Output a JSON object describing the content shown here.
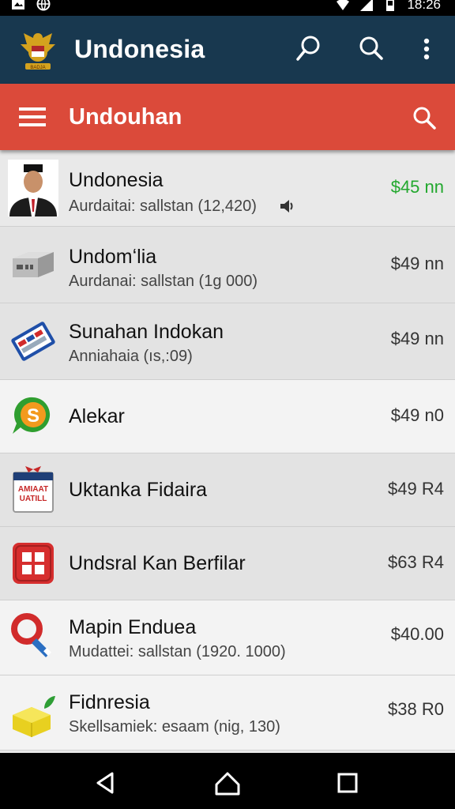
{
  "statusbar": {
    "time": "18:26"
  },
  "appbar": {
    "title": "Undonesia",
    "logo_text": "BADJA"
  },
  "toolbar": {
    "title": "Undouhan"
  },
  "items": [
    {
      "name": "Undonesia",
      "sub": "Aurdaitai:   sallstan (12,420)",
      "price": "$45 nn",
      "price_color": "#22a82e",
      "icon": "person-portrait-icon"
    },
    {
      "name": "Undomʻlia",
      "sub": "Aurdanai:   sallstan (1g 000)",
      "price": "$49 nn",
      "icon": "router-device-icon"
    },
    {
      "name": "Sunahan Indokan",
      "sub": "Anniahaia  (ıs,:09)",
      "price": "$49 nn",
      "icon": "calendar-card-icon"
    },
    {
      "name": "Alekar",
      "sub": "",
      "price": "$49 n0",
      "icon": "dollar-chat-icon"
    },
    {
      "name": "Uktanka Fidaira",
      "sub": "",
      "price": "$49 R4",
      "icon": "gift-calendar-icon",
      "icon_text": "AMIAAT UATILL"
    },
    {
      "name": "Undsral Kan Berfilar",
      "sub": "",
      "price": "$63 R4",
      "icon": "grid-app-icon"
    },
    {
      "name": "Mapin Enduea",
      "sub": "Mudattei:   sallstan (1920. 1000)",
      "price": "$40.00",
      "icon": "magnifier-tag-icon"
    },
    {
      "name": "Fidnresia",
      "sub": "Skellsamiek:   esaam (nig, 130)",
      "price": "$38 R0",
      "icon": "butter-leaf-icon"
    }
  ]
}
